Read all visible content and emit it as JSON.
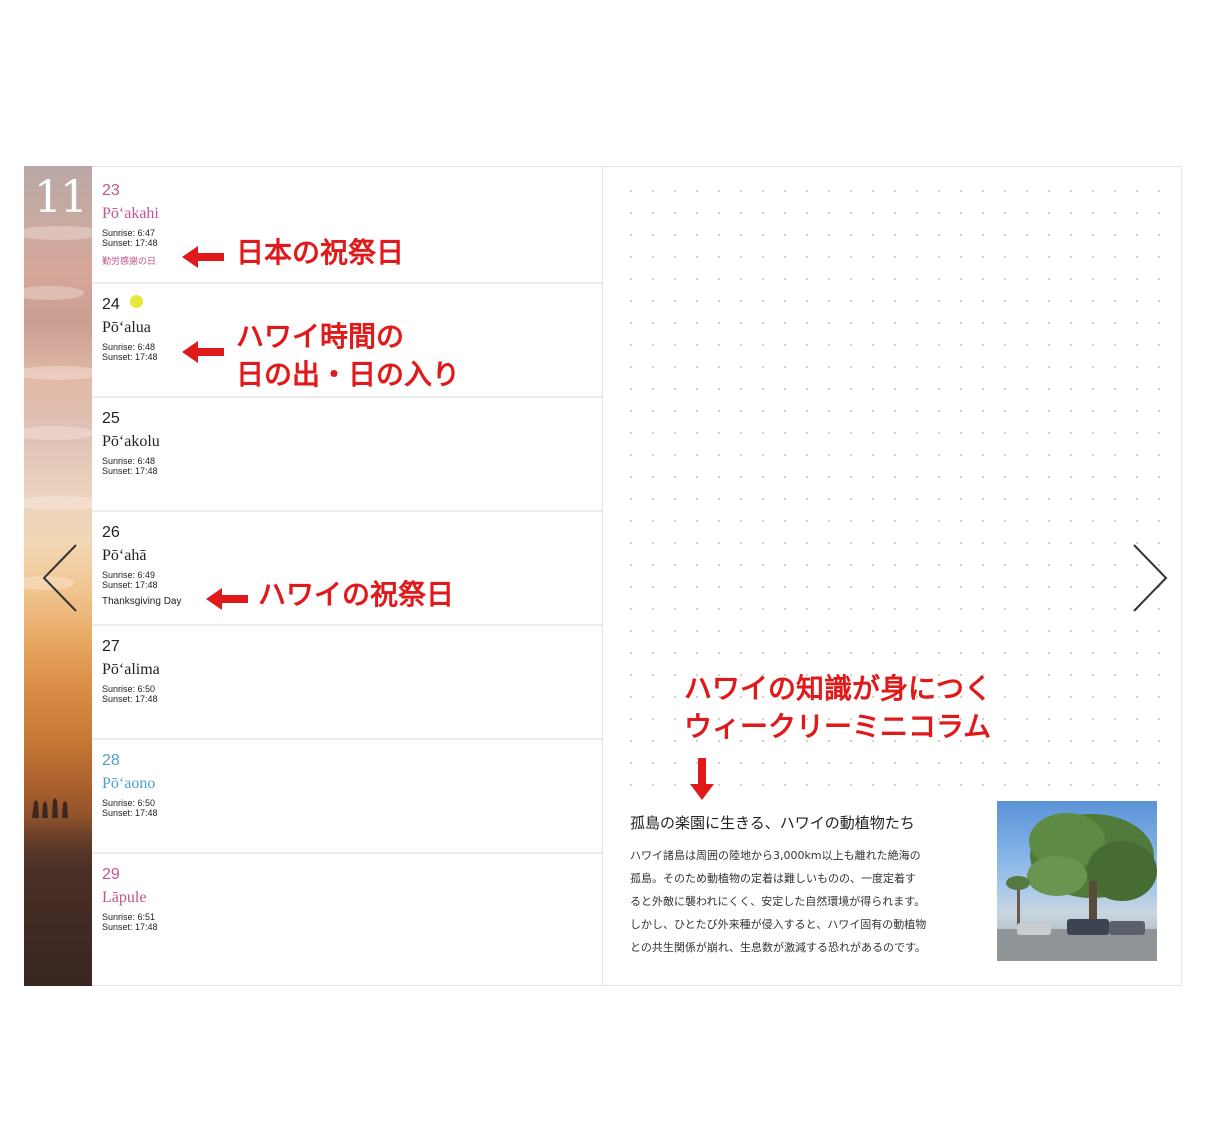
{
  "month": "11",
  "days": [
    {
      "num": "23",
      "name": "Pōʻakahi",
      "sunrise": "Sunrise: 6:47",
      "sunset": "Sunset: 17:48",
      "holiday": "勤労感謝の日"
    },
    {
      "num": "24",
      "name": "Pōʻalua",
      "sunrise": "Sunrise: 6:48",
      "sunset": "Sunset: 17:48"
    },
    {
      "num": "25",
      "name": "Pōʻakolu",
      "sunrise": "Sunrise: 6:48",
      "sunset": "Sunset: 17:48"
    },
    {
      "num": "26",
      "name": "Pōʻahā",
      "sunrise": "Sunrise: 6:49",
      "sunset": "Sunset: 17:48",
      "holiday": "Thanksgiving Day"
    },
    {
      "num": "27",
      "name": "Pōʻalima",
      "sunrise": "Sunrise: 6:50",
      "sunset": "Sunset: 17:48"
    },
    {
      "num": "28",
      "name": "Pōʻaono",
      "sunrise": "Sunrise: 6:50",
      "sunset": "Sunset: 17:48"
    },
    {
      "num": "29",
      "name": "Lāpule",
      "sunrise": "Sunrise: 6:51",
      "sunset": "Sunset: 17:48"
    }
  ],
  "annotations": {
    "japan_holiday": "日本の祝祭日",
    "sun_times_line1": "ハワイ時間の",
    "sun_times_line2": "日の出・日の入り",
    "hawaii_holiday": "ハワイの祝祭日",
    "column_line1": "ハワイの知識が身につく",
    "column_line2": "ウィークリーミニコラム"
  },
  "column": {
    "title": "孤島の楽園に生きる、ハワイの動植物たち",
    "lines": [
      "ハワイ諸島は周囲の陸地から3,000km以上も離れた絶海の",
      "孤島。そのため動植物の定着は難しいものの、一度定着す",
      "ると外敵に襲われにくく、安定した自然環境が得られます。",
      "しかし、ひとたび外来種が侵入すると、ハワイ固有の動植物",
      "との共生関係が崩れ、生息数が激減する恐れがあるのです。"
    ]
  },
  "colors": {
    "annotation": "#e0191b",
    "weekend_pink": "#c0558e",
    "saturday_blue": "#4aa3cc",
    "moon": "#e8e83a"
  },
  "icons": {
    "prev": "chevron-left-icon",
    "next": "chevron-right-icon"
  }
}
